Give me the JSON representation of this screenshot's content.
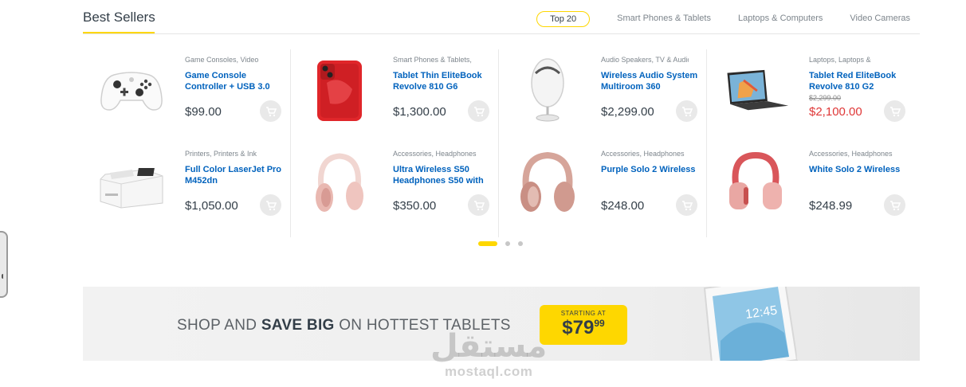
{
  "section": {
    "title": "Best Sellers",
    "tabs": [
      "Top 20",
      "Smart Phones & Tablets",
      "Laptops & Computers",
      "Video Cameras"
    ],
    "active_tab": "Top 20"
  },
  "products": [
    {
      "category": "Game Consoles, Video",
      "name": "Game Console Controller + USB 3.0",
      "price": "$99.00",
      "old_price": "",
      "image": "game-controller-icon"
    },
    {
      "category": "Smart Phones & Tablets,",
      "name": "Tablet Thin EliteBook Revolve 810 G6",
      "price": "$1,300.00",
      "old_price": "",
      "image": "red-smartphone-icon"
    },
    {
      "category": "Audio Speakers, TV & Audio",
      "name": "Wireless Audio System Multiroom 360",
      "price": "$2,299.00",
      "old_price": "",
      "image": "speaker-icon"
    },
    {
      "category": "Laptops, Laptops &",
      "name": "Tablet Red EliteBook Revolve 810 G2",
      "price": "$2,100.00",
      "old_price": "$2,299.00",
      "image": "tablet-keyboard-icon"
    },
    {
      "category": "Printers, Printers & Ink",
      "name": "Full Color LaserJet Pro M452dn",
      "price": "$1,050.00",
      "old_price": "",
      "image": "printer-icon"
    },
    {
      "category": "Accessories, Headphones",
      "name": "Ultra Wireless S50 Headphones S50 with",
      "price": "$350.00",
      "old_price": "",
      "image": "pink-headphones-icon"
    },
    {
      "category": "Accessories, Headphones",
      "name": "Purple Solo 2 Wireless",
      "price": "$248.00",
      "old_price": "",
      "image": "rose-headphones-icon"
    },
    {
      "category": "Accessories, Headphones",
      "name": "White Solo 2 Wireless",
      "price": "$248.99",
      "old_price": "",
      "image": "red-headphones-icon"
    }
  ],
  "carousel": {
    "pages": 3,
    "active": 1
  },
  "banner": {
    "text_pre": "SHOP AND ",
    "text_bold": "SAVE BIG",
    "text_post": " ON HOTTEST TABLETS",
    "badge_label": "STARTING AT",
    "badge_price": "$79",
    "badge_cents": "99",
    "tablet_time": "12:45"
  },
  "watermark": {
    "arabic": "مستقل",
    "latin": "mostaql.com"
  },
  "colors": {
    "accent": "#fed700",
    "link": "#0062bd",
    "sale": "#df3737",
    "text": "#333e48"
  }
}
